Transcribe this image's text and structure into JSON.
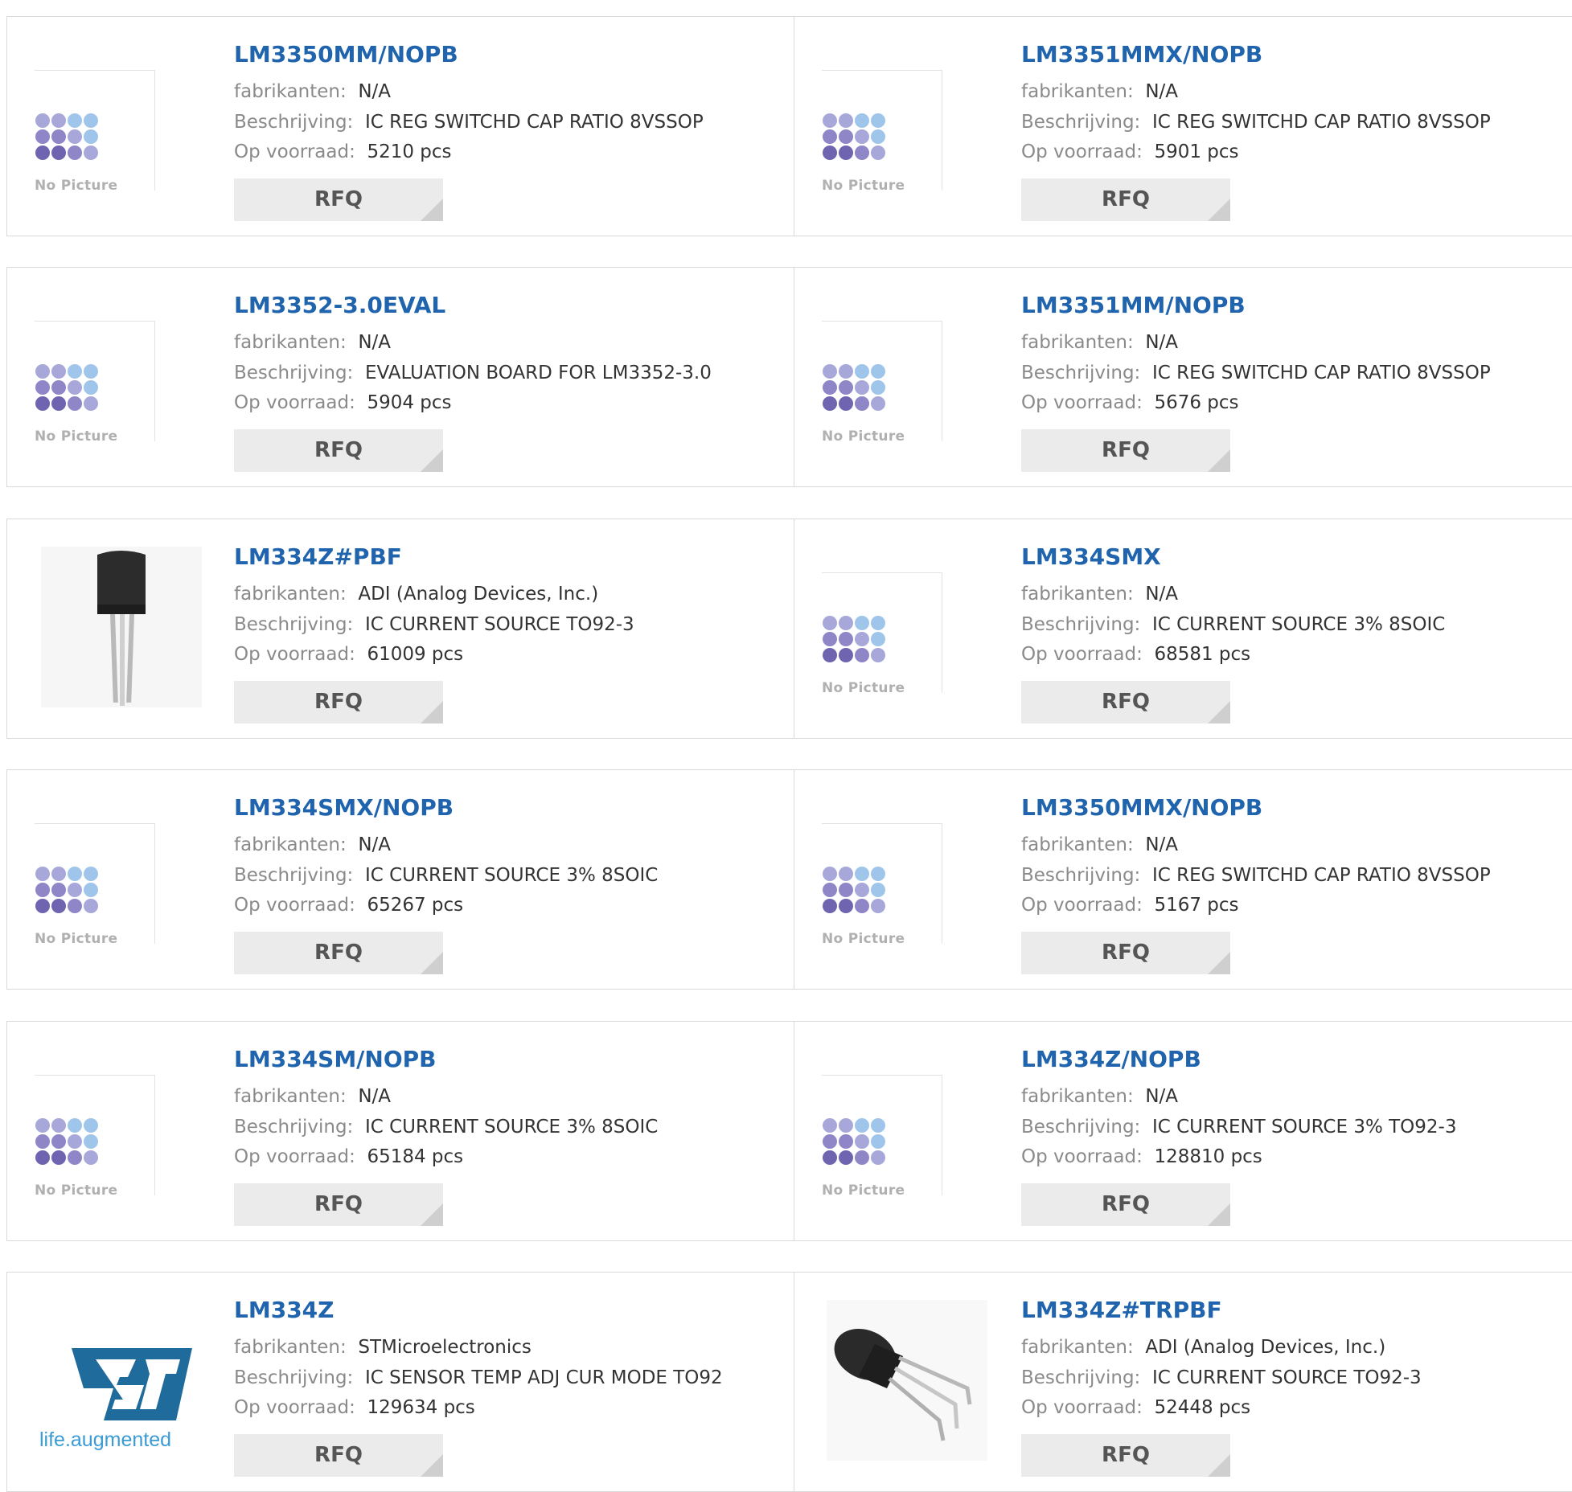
{
  "labels": {
    "manufacturer": "fabrikanten:",
    "description": "Beschrijving:",
    "stock": "Op voorraad:",
    "rfq": "RFQ",
    "no_picture": "No Picture",
    "st_slogan": "life.augmented"
  },
  "products": [
    {
      "name": "LM3350MM/NOPB",
      "manufacturer": "N/A",
      "description": "IC REG SWITCHD CAP RATIO 8VSSOP",
      "stock": "5210 pcs",
      "image": "no-picture"
    },
    {
      "name": "LM3351MMX/NOPB",
      "manufacturer": "N/A",
      "description": "IC REG SWITCHD CAP RATIO 8VSSOP",
      "stock": "5901 pcs",
      "image": "no-picture"
    },
    {
      "name": "LM3352-3.0EVAL",
      "manufacturer": "N/A",
      "description": "EVALUATION BOARD FOR LM3352-3.0",
      "stock": "5904 pcs",
      "image": "no-picture"
    },
    {
      "name": "LM3351MM/NOPB",
      "manufacturer": "N/A",
      "description": "IC REG SWITCHD CAP RATIO 8VSSOP",
      "stock": "5676 pcs",
      "image": "no-picture"
    },
    {
      "name": "LM334Z#PBF",
      "manufacturer": "ADI (Analog Devices, Inc.)",
      "description": "IC CURRENT SOURCE TO92-3",
      "stock": "61009 pcs",
      "image": "to92-vertical"
    },
    {
      "name": "LM334SMX",
      "manufacturer": "N/A",
      "description": "IC CURRENT SOURCE 3% 8SOIC",
      "stock": "68581 pcs",
      "image": "no-picture"
    },
    {
      "name": "LM334SMX/NOPB",
      "manufacturer": "N/A",
      "description": "IC CURRENT SOURCE 3% 8SOIC",
      "stock": "65267 pcs",
      "image": "no-picture"
    },
    {
      "name": "LM3350MMX/NOPB",
      "manufacturer": "N/A",
      "description": "IC REG SWITCHD CAP RATIO 8VSSOP",
      "stock": "5167 pcs",
      "image": "no-picture"
    },
    {
      "name": "LM334SM/NOPB",
      "manufacturer": "N/A",
      "description": "IC CURRENT SOURCE 3% 8SOIC",
      "stock": "65184 pcs",
      "image": "no-picture"
    },
    {
      "name": "LM334Z/NOPB",
      "manufacturer": "N/A",
      "description": "IC CURRENT SOURCE 3% TO92-3",
      "stock": "128810 pcs",
      "image": "no-picture"
    },
    {
      "name": "LM334Z",
      "manufacturer": "STMicroelectronics",
      "description": "IC SENSOR TEMP ADJ CUR MODE TO92",
      "stock": "129634 pcs",
      "image": "st-logo"
    },
    {
      "name": "LM334Z#TRPBF",
      "manufacturer": "ADI (Analog Devices, Inc.)",
      "description": "IC CURRENT SOURCE TO92-3",
      "stock": "52448 pcs",
      "image": "to92-angled"
    }
  ],
  "colors": {
    "link": "#1f64ad",
    "label": "#8a8a8a",
    "value": "#333333",
    "rfq_bg": "#ebebeb",
    "border": "#d9d9d9",
    "st_blue": "#1e6b9c"
  }
}
